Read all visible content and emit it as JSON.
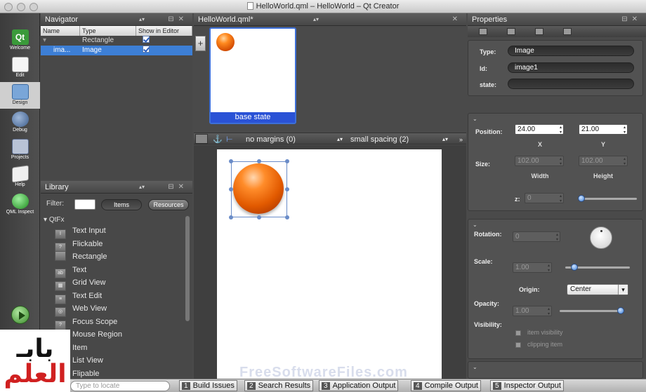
{
  "window": {
    "title": "HelloWorld.qml – HelloWorld – Qt Creator"
  },
  "modes": [
    {
      "label": "Welcome",
      "icon": "qt-logo-icon"
    },
    {
      "label": "Edit",
      "icon": "edit-icon"
    },
    {
      "label": "Design",
      "icon": "design-icon"
    },
    {
      "label": "Debug",
      "icon": "debug-icon"
    },
    {
      "label": "Projects",
      "icon": "projects-icon"
    },
    {
      "label": "Help",
      "icon": "help-icon"
    },
    {
      "label": "QML Inspect",
      "icon": "qml-inspect-icon"
    }
  ],
  "active_mode": "Design",
  "navigator": {
    "title": "Navigator",
    "columns": [
      "Name",
      "Type",
      "Show in Editor"
    ],
    "rows": [
      {
        "name": "",
        "type": "Rectangle",
        "show": true
      },
      {
        "name": "ima...",
        "type": "Image",
        "show": true
      }
    ]
  },
  "library": {
    "title": "Library",
    "filter_label": "Filter:",
    "tabs": [
      "Items",
      "Resources"
    ],
    "category": "QtFx",
    "items": [
      {
        "label": "Text Input",
        "icon": "text-input-icon",
        "glyph": "I"
      },
      {
        "label": "Flickable",
        "icon": "flickable-icon",
        "glyph": "?"
      },
      {
        "label": "Rectangle",
        "icon": "rectangle-icon",
        "glyph": ""
      },
      {
        "label": "Text",
        "icon": "text-icon",
        "glyph": "ab"
      },
      {
        "label": "Grid View",
        "icon": "grid-view-icon",
        "glyph": "▦"
      },
      {
        "label": "Text Edit",
        "icon": "text-edit-icon",
        "glyph": "≡"
      },
      {
        "label": "Web View",
        "icon": "web-view-icon",
        "glyph": "◎"
      },
      {
        "label": "Focus Scope",
        "icon": "focus-scope-icon",
        "glyph": "?"
      },
      {
        "label": "Mouse Region",
        "icon": "mouse-region-icon",
        "glyph": "↖"
      },
      {
        "label": "Item",
        "icon": "item-icon",
        "glyph": "?"
      },
      {
        "label": "List View",
        "icon": "list-view-icon",
        "glyph": "☰"
      },
      {
        "label": "Flipable",
        "icon": "flipable-icon",
        "glyph": "?"
      }
    ]
  },
  "editor": {
    "tab": "HelloWorld.qml*",
    "state_label": "base state",
    "add_state": "+",
    "margins": "no margins (0)",
    "spacing": "small spacing (2)"
  },
  "watermark": "FreeSoftwareFiles.com",
  "properties": {
    "title": "Properties",
    "type_label": "Type:",
    "type_value": "Image",
    "id_label": "Id:",
    "id_value": "image1",
    "state_label": "state:",
    "state_value": "",
    "position_label": "Position:",
    "x": "24.00",
    "y": "21.00",
    "x_label": "X",
    "y_label": "Y",
    "size_label": "Size:",
    "width": "102.00",
    "height": "102.00",
    "width_label": "Width",
    "height_label": "Height",
    "z_label": "z:",
    "z": "0",
    "rotation_label": "Rotation:",
    "rotation": "0",
    "scale_label": "Scale:",
    "scale": "1.00",
    "origin_label": "Origin:",
    "origin": "Center",
    "opacity_label": "Opacity:",
    "opacity": "1.00",
    "visibility_label": "Visibility:",
    "item_visibility": "item visibility",
    "clipping_item": "clipping item",
    "z_slider_level": 0.0,
    "scale_slider_level": 0.1,
    "opacity_slider_level": 1.0
  },
  "bottom": {
    "locate_placeholder": "Type to locate",
    "tabs": [
      {
        "n": "1",
        "label": "Build Issues"
      },
      {
        "n": "2",
        "label": "Search Results"
      },
      {
        "n": "3",
        "label": "Application Output"
      },
      {
        "n": "4",
        "label": "Compile Output"
      },
      {
        "n": "5",
        "label": "Inspector Output"
      }
    ]
  },
  "corner_logo": {
    "line1": "بابـ",
    "line2": "العلم"
  }
}
